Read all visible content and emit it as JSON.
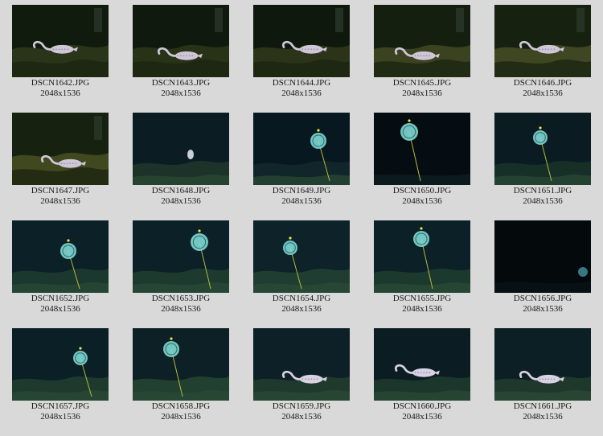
{
  "gallery": {
    "items": [
      {
        "filename": "DSCN1642.JPG",
        "dimensions": "2048x1536",
        "scene": "rocky-dark",
        "subject": "flamingo-creature",
        "bg": "#101a0d",
        "rock": "#2a3418"
      },
      {
        "filename": "DSCN1643.JPG",
        "dimensions": "2048x1536",
        "scene": "rocky-dark",
        "subject": "flamingo-creature",
        "bg": "#0f190d",
        "rock": "#283217"
      },
      {
        "filename": "DSCN1644.JPG",
        "dimensions": "2048x1536",
        "scene": "rocky-dark",
        "subject": "flamingo-creature",
        "bg": "#0f180c",
        "rock": "#2b3318"
      },
      {
        "filename": "DSCN1645.JPG",
        "dimensions": "2048x1536",
        "scene": "rocky-moss",
        "subject": "flamingo-creature",
        "bg": "#151f10",
        "rock": "#3a4220"
      },
      {
        "filename": "DSCN1646.JPG",
        "dimensions": "2048x1536",
        "scene": "rocky-moss",
        "subject": "flamingo-creature",
        "bg": "#162110",
        "rock": "#3f4722"
      },
      {
        "filename": "DSCN1647.JPG",
        "dimensions": "2048x1536",
        "scene": "rocky-moss",
        "subject": "flamingo-creature",
        "bg": "#162110",
        "rock": "#40481f"
      },
      {
        "filename": "DSCN1648.JPG",
        "dimensions": "2048x1536",
        "scene": "deep-blue",
        "subject": "small-creature",
        "bg": "#0b1c22",
        "rock": "#1d3229"
      },
      {
        "filename": "DSCN1649.JPG",
        "dimensions": "2048x1536",
        "scene": "deep-blue",
        "subject": "disc-on-stalk",
        "bg": "#081820",
        "rock": "#10262a"
      },
      {
        "filename": "DSCN1650.JPG",
        "dimensions": "2048x1536",
        "scene": "deep-black",
        "subject": "disc-on-stalk",
        "bg": "#050d12",
        "rock": "#0b1a1e"
      },
      {
        "filename": "DSCN1651.JPG",
        "dimensions": "2048x1536",
        "scene": "deep-blue",
        "subject": "disc-on-stalk",
        "bg": "#0a1c22",
        "rock": "#163028"
      },
      {
        "filename": "DSCN1652.JPG",
        "dimensions": "2048x1536",
        "scene": "deep-blue",
        "subject": "disc-on-stalk",
        "bg": "#0c2028",
        "rock": "#1b382e"
      },
      {
        "filename": "DSCN1653.JPG",
        "dimensions": "2048x1536",
        "scene": "deep-blue",
        "subject": "disc-on-stalk",
        "bg": "#0c2028",
        "rock": "#1d3a2f"
      },
      {
        "filename": "DSCN1654.JPG",
        "dimensions": "2048x1536",
        "scene": "deep-blue",
        "subject": "disc-on-stalk",
        "bg": "#0d2229",
        "rock": "#1f3d30"
      },
      {
        "filename": "DSCN1655.JPG",
        "dimensions": "2048x1536",
        "scene": "deep-blue",
        "subject": "disc-on-stalk",
        "bg": "#0c2027",
        "rock": "#1c392d"
      },
      {
        "filename": "DSCN1656.JPG",
        "dimensions": "2048x1536",
        "scene": "deep-black",
        "subject": "small-disc",
        "bg": "#04090c",
        "rock": "#071115"
      },
      {
        "filename": "DSCN1657.JPG",
        "dimensions": "2048x1536",
        "scene": "deep-blue",
        "subject": "disc-on-stalk",
        "bg": "#0b1f26",
        "rock": "#1e3a2d"
      },
      {
        "filename": "DSCN1658.JPG",
        "dimensions": "2048x1536",
        "scene": "deep-blue",
        "subject": "disc-on-stalk",
        "bg": "#0c2026",
        "rock": "#21402f"
      },
      {
        "filename": "DSCN1659.JPG",
        "dimensions": "2048x1536",
        "scene": "deep-blue",
        "subject": "flamingo-creature",
        "bg": "#0d2027",
        "rock": "#1f3a2c"
      },
      {
        "filename": "DSCN1660.JPG",
        "dimensions": "2048x1536",
        "scene": "deep-blue",
        "subject": "flamingo-creature",
        "bg": "#0b1d23",
        "rock": "#1b362a"
      },
      {
        "filename": "DSCN1661.JPG",
        "dimensions": "2048x1536",
        "scene": "deep-blue",
        "subject": "flamingo-creature",
        "bg": "#0c1f24",
        "rock": "#1e392b"
      }
    ]
  }
}
